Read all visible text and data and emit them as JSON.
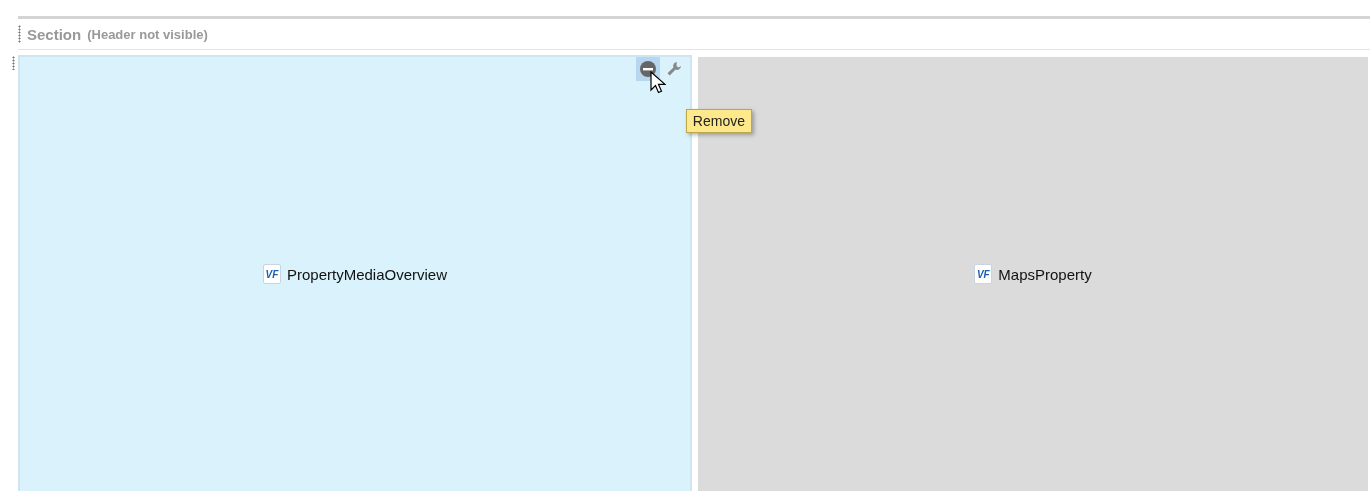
{
  "section": {
    "title": "Section",
    "note": "(Header not visible)"
  },
  "components": [
    {
      "badge": "VF",
      "name": "PropertyMediaOverview",
      "selected": true,
      "remove_hovered": true,
      "tooltip": "Remove"
    },
    {
      "badge": "VF",
      "name": "MapsProperty",
      "selected": false,
      "remove_hovered": false
    }
  ]
}
